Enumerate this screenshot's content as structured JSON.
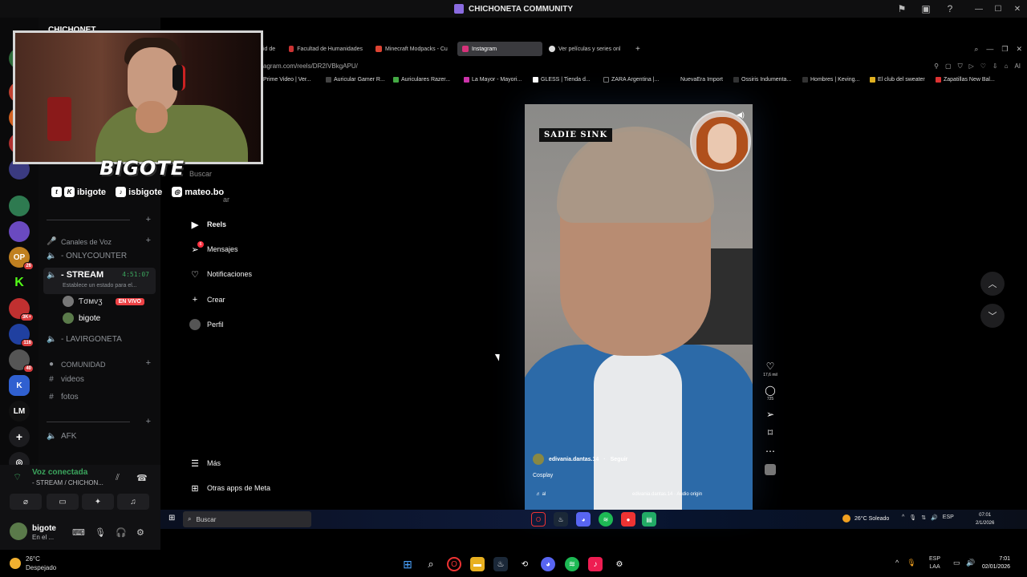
{
  "window": {
    "title": "CHICHONETA COMMUNITY"
  },
  "rail": {
    "badges": [
      "26",
      "3K+",
      "116",
      "40"
    ],
    "labels": {
      "lm": "LM",
      "op": "OP",
      "k": "K"
    }
  },
  "channels": {
    "server_name": "CHICHONET",
    "voice_category": "Canales de Voz",
    "items": [
      {
        "name": "- ONLYCOUNTER"
      },
      {
        "name": "- STREAM",
        "time": "4:51:07",
        "sub": "Establece un estado para el..."
      },
      {
        "name": "- LAVIRGONETA"
      }
    ],
    "members": [
      {
        "name": "Ƭσмνʒ",
        "badge": "EN VIVO"
      },
      {
        "name": "bigote"
      }
    ],
    "community_category": "COMUNIDAD",
    "text_channels": [
      "videos",
      "fotos"
    ],
    "afk": "AFK"
  },
  "voice": {
    "status": "Voz conectada",
    "sub": "- STREAM / CHICHON..."
  },
  "user": {
    "name": "bigote",
    "status": "En el ..."
  },
  "overlay": {
    "brand": "BIGOTE",
    "socials": [
      "ibigote",
      "isbigote",
      "mateo.bo"
    ]
  },
  "browser": {
    "tabs": [
      {
        "label": "id de"
      },
      {
        "label": "Facultad de Humanidades"
      },
      {
        "label": "Minecraft Modpacks - Cu"
      },
      {
        "label": "Instagram",
        "active": true
      },
      {
        "label": "Ver películas y series onl"
      }
    ],
    "url": "agram.com/reels/DR2IVBkgAPU/",
    "bookmarks": [
      "Prime Video | Ver...",
      "Auricular Gamer R...",
      "Auriculares Razer...",
      "La Mayor - Mayori...",
      "GLESS | Tienda d...",
      "ZARA Argentina |...",
      "NuevaEra Import",
      "Ossiris Indumenta...",
      "Hombres | Keving...",
      "El club del sweater",
      "Zapatillas New Bal..."
    ]
  },
  "instagram": {
    "nav": {
      "search": "Buscar",
      "explore": "ar",
      "reels": "Reels",
      "messages": "Mensajes",
      "messages_badge": "6",
      "notifications": "Notificaciones",
      "create": "Crear",
      "profile": "Perfil",
      "more": "Más",
      "meta": "Otras apps de Meta"
    },
    "reel": {
      "label": "SADIE SINK",
      "username": "edivania.dantas.14",
      "follow": "Seguir",
      "caption": "Cosplay",
      "audio_left": "al",
      "audio": "edivania.dantas.14 · Audio origin",
      "likes": "17,6 mil",
      "comments": "725"
    }
  },
  "inner_taskbar": {
    "search": "Buscar",
    "weather": "26°C Soleado",
    "lang": "ESP",
    "time": "07:01",
    "date": "2/1/2026"
  },
  "taskbar": {
    "temp": "26°C",
    "condition": "Despejado",
    "lang1": "ESP",
    "lang2": "LAA",
    "time": "7:01",
    "date": "02/01/2026"
  },
  "colors": {
    "voice_green": "#3ba55d",
    "live_red": "#ed4245",
    "rail_bg": "#0a0a0b",
    "ig_dot": "#ff3040"
  }
}
